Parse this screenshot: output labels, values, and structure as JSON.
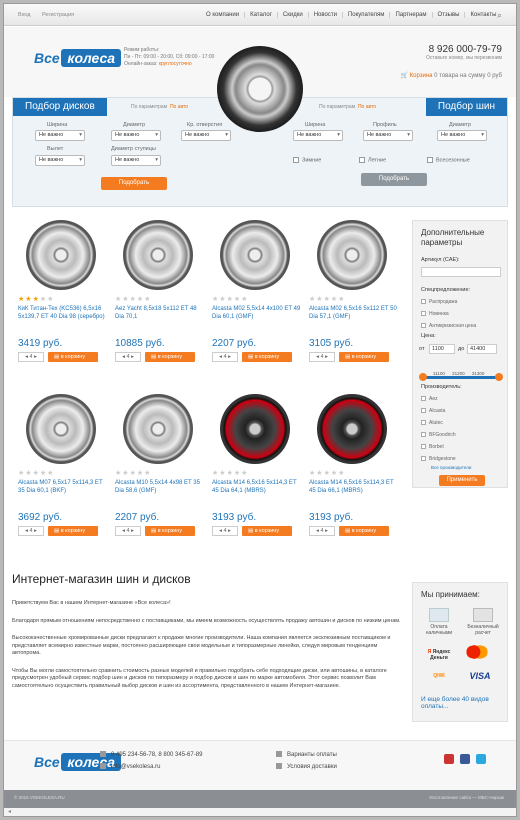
{
  "topnav": {
    "left": [
      "Вход",
      "Регистрация"
    ],
    "menu": [
      "О компании",
      "Каталог",
      "Скидки",
      "Новости",
      "Покупателям",
      "Партнерам",
      "Отзывы",
      "Контакты"
    ]
  },
  "header": {
    "logo_left": "Все",
    "logo_right": "колеса",
    "hours_label": "Режим работы:",
    "hours_1": "Пн - Пт: 09:00 - 20:00, Сб: 09:00 - 17:00",
    "online_label": "Онлайн-заказ:",
    "online_value": "круглосуточно",
    "phone": "8 926 000-79-79",
    "phone_note": "Оставьте номер, мы перезвоним",
    "cart_label": "Корзина",
    "cart_info": "0 товара на сумму 0 руб"
  },
  "finder": {
    "discs_title": "Подбор дисков",
    "tires_title": "Подбор шин",
    "by_params": "По параметрам",
    "by_auto": "По авто",
    "disc_fields": [
      {
        "label": "Ширина",
        "value": "Не важно"
      },
      {
        "label": "Диаметр",
        "value": "Не важно"
      },
      {
        "label": "Кр. отверстия",
        "value": "Не важно"
      },
      {
        "label": "Вылет",
        "value": "Не важно"
      },
      {
        "label": "Диаметр ступицы",
        "value": "Не важно"
      }
    ],
    "tire_fields": [
      {
        "label": "Ширина",
        "value": "Не важно"
      },
      {
        "label": "Профиль",
        "value": "Не важно"
      },
      {
        "label": "Диаметр",
        "value": "Не важно"
      }
    ],
    "seasons": [
      "Зимние",
      "Летние",
      "Всесезонные"
    ],
    "pick_button": "Подобрать"
  },
  "products": [
    {
      "name": "КиК Титан-Тех (KC536) 6,5x16 5x139,7 ET 40 Dia 98 (серебро)",
      "price": "3419 руб.",
      "rating": 3,
      "style": "s"
    },
    {
      "name": "Aez Yacht 8,5x18 5x112 ET 48 Dia 70,1",
      "price": "10885 руб.",
      "rating": 0,
      "style": "s"
    },
    {
      "name": "Alcasta M02 5,5x14 4x100 ET 49 Dia 60,1 (GMF)",
      "price": "2207 руб.",
      "rating": 0,
      "style": "s"
    },
    {
      "name": "Alcasta M02 6,5x16 5x112 ET 50 Dia 57,1 (GMF)",
      "price": "3105 руб.",
      "rating": 0,
      "style": "s"
    },
    {
      "name": "Alcasta M07 6,5x17 5x114,3 ET 35 Dia 60,1 (BKF)",
      "price": "3692 руб.",
      "rating": 0,
      "style": "s"
    },
    {
      "name": "Alcasta M10 5,5x14 4x98 ET 35 Dia 58,6 (GMF)",
      "price": "2207 руб.",
      "rating": 0,
      "style": "s"
    },
    {
      "name": "Alcasta M14 6,5x16 5x114,3 ET 45 Dia 64,1 (MBRS)",
      "price": "3193 руб.",
      "rating": 0,
      "style": "b"
    },
    {
      "name": "Alcasta M14 6,5x16 5x114,3 ET 45 Dia 66,1 (MBRS)",
      "price": "3193 руб.",
      "rating": 0,
      "style": "b"
    }
  ],
  "product_ui": {
    "qty": "4",
    "to_cart": "в корзину"
  },
  "sidebar": {
    "title": "Дополнительные параметры",
    "article_label": "Артикул (CAE):",
    "special_label": "Спецпредложение:",
    "specials": [
      "Распродажа",
      "Новинка",
      "Антикризисная цена"
    ],
    "price_label": "Цена:",
    "price_from_label": "от",
    "price_from": "1100",
    "price_to_label": "до",
    "price_to": "41400",
    "ticks": [
      "11100",
      "21200",
      "31300"
    ],
    "maker_label": "Производитель:",
    "makers": [
      "Aez",
      "Alcasta",
      "Alutec",
      "BFGoodrich",
      "Borbet",
      "Bridgestone"
    ],
    "all_makers": "Все производители",
    "apply": "Применить"
  },
  "about": {
    "title": "Интернет-магазин шин и дисков",
    "p1": "Приветствуем Вас в нашем Интернет-магазине «Все колеса»!",
    "p2": "Благодаря прямым отношениям непосредственно с поставщиками, мы имеем возможность осуществлять продажу автошин и дисков по низким ценам.",
    "p3": "Высококачественные хромированные диски предлагают к продаже многие производители. Наша компания является эксклюзивным поставщиком и представляет всемирно известные марки, постоянно расширяющие свои модельные и типоразмерные линейки, следуя мировым тенденциям автопрома.",
    "p4": "Чтобы Вы могли самостоятельно сравнить стоимость разных моделей и правильно подобрать себе подходящие диски, или автошины, в каталоге предусмотрен удобный сервис подбор шин и дисков по типоразмеру и подбор дисков и шин по марке автомобиля. Этот сервис позволит Вам самостоятельно осуществить правильный выбор дисков и шин из ассортимента, представленного в нашем Интернет-магазине."
  },
  "accept": {
    "title": "Мы принимаем:",
    "cash": "Оплата наличными",
    "bank": "Безналичный расчет",
    "yandex": "Яндекс Деньги",
    "qiwi": "QIWI",
    "more": "И еще более 40 видов оплаты..."
  },
  "footer": {
    "logo_left": "Все",
    "logo_right": "колеса",
    "phones": "8 495 234-56-78, 8 800 345-67-89",
    "email": "info@vsekolesa.ru",
    "pay_link": "Варианты оплаты",
    "ship_link": "Условия доставки"
  },
  "bottom": {
    "copyright": "© 2015 VSEKOLESA.RU",
    "credit": "Изготовление сайта — МБС-Нарым"
  }
}
